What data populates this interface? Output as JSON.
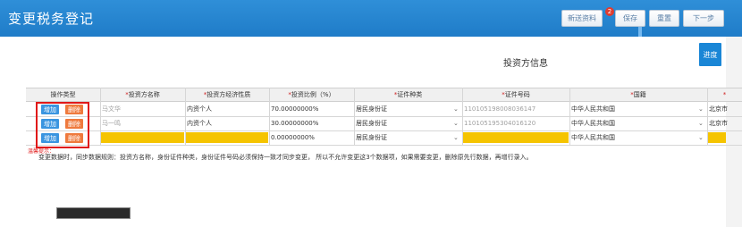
{
  "header": {
    "title": "变更税务登记",
    "buttons": {
      "new_material": "新送资料",
      "save": "保存",
      "reset": "重置",
      "next": "下一步"
    },
    "badge_count": "2"
  },
  "panel": {
    "ok_button": "进度",
    "section_title": "投资方信息"
  },
  "table": {
    "headers": {
      "op_type": "操作类型",
      "investor_name": "投资方名称",
      "economic_nature": "投资方经济性质",
      "ratio": "投资比例（%）",
      "id_type": "证件种类",
      "id_number": "证件号码",
      "nationality": "国籍",
      "address": ""
    },
    "actions": {
      "add": "增加",
      "delete": "删除"
    },
    "rows": [
      {
        "name": "马文华",
        "nature": "内资个人",
        "ratio": "70.00000000%",
        "id_type": "居民身份证",
        "id_number": "110105198008036147",
        "nationality": "中华人民共和国",
        "address": "北京市"
      },
      {
        "name": "马一鸣",
        "nature": "内资个人",
        "ratio": "30.00000000%",
        "id_type": "居民身份证",
        "id_number": "110105195304016120",
        "nationality": "中华人民共和国",
        "address": "北京市"
      },
      {
        "name": "",
        "nature": "",
        "ratio": "0.00000000%",
        "id_type": "居民身份证",
        "id_number": "",
        "nationality": "中华人民共和国",
        "address": ""
      }
    ]
  },
  "notes": {
    "red": "温馨提示：",
    "rule": "变更数据时，同步数据规则：投资方名称，身份证件种类，身份证件号码必须保持一致才同步变更， 所以不允许变更这3个数据项，如果需要变更，删除原先行数据，再增行录入。"
  },
  "colors": {
    "header_blue": "#1f7cc8",
    "required_red": "#d02020",
    "highlight_yellow": "#f5c400",
    "add_blue": "#3a95e0",
    "delete_orange": "#ef7a3d"
  }
}
